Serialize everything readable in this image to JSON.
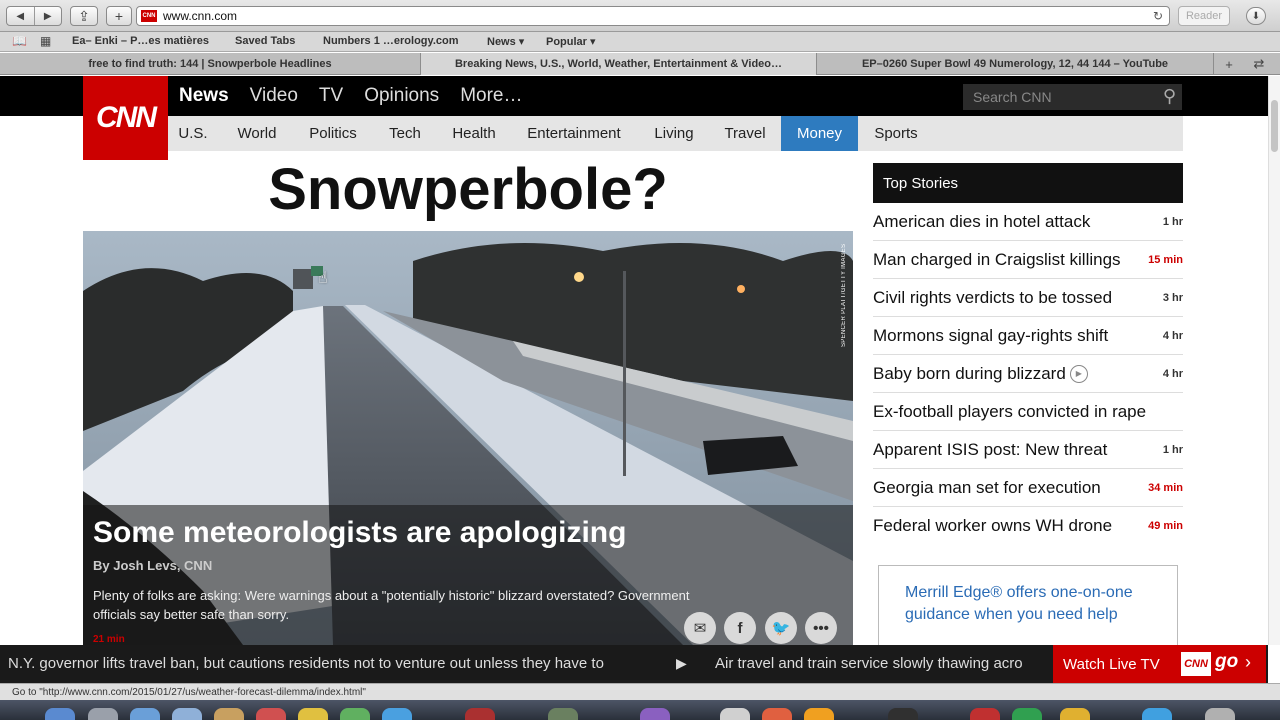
{
  "browser": {
    "url": "www.cnn.com",
    "reader_label": "Reader",
    "bookmarks": [
      "Ea– Enki – P…es matières",
      "Saved Tabs",
      "Numbers 1 …erology.com",
      "News ▾",
      "Popular ▾"
    ],
    "tabs": [
      "free to find truth: 144 | Snowperbole Headlines",
      "Breaking News, U.S., World, Weather, Entertainment & Video…",
      "EP–0260 Super Bowl 49 Numerology, 12, 44 144 – YouTube"
    ],
    "status_text": "Go to \"http://www.cnn.com/2015/01/27/us/weather-forecast-dilemma/index.html\""
  },
  "cnn": {
    "logo": "CNN",
    "main_nav": [
      "News",
      "Video",
      "TV",
      "Opinions",
      "More…"
    ],
    "search_placeholder": "Search CNN",
    "sub_nav": [
      "U.S.",
      "World",
      "Politics",
      "Tech",
      "Health",
      "Entertainment",
      "Living",
      "Travel",
      "Money",
      "Sports"
    ],
    "headline": "Snowperbole?",
    "hero": {
      "photo_credit": "SPENCER PLATT/GETTY IMAGES",
      "title": "Some meteorologists are apologizing",
      "byline": "By Josh Levs, CNN",
      "summary": "Plenty of folks are asking: Were warnings about a \"potentially historic\" blizzard overstated? Government officials say better safe than sorry.",
      "time": "21 min"
    },
    "top_stories": {
      "header": "Top Stories",
      "items": [
        {
          "title": "American dies in hotel attack",
          "time": "1 hr",
          "recent": false
        },
        {
          "title": "Man charged in Craigslist killings",
          "time": "15 min",
          "recent": true
        },
        {
          "title": "Civil rights verdicts to be tossed",
          "time": "3 hr",
          "recent": false
        },
        {
          "title": "Mormons signal gay-rights shift",
          "time": "4 hr",
          "recent": false
        },
        {
          "title": "Baby born during blizzard",
          "time": "4 hr",
          "recent": false,
          "video": true
        },
        {
          "title": "Ex-football players convicted in rape",
          "time": "",
          "recent": false
        },
        {
          "title": "Apparent ISIS post: New threat",
          "time": "1 hr",
          "recent": false
        },
        {
          "title": "Georgia man set for execution",
          "time": "34 min",
          "recent": true
        },
        {
          "title": "Federal worker owns WH drone",
          "time": "49 min",
          "recent": true
        }
      ]
    },
    "ad_text": "Merrill Edge® offers one-on-one guidance when you need help",
    "ticker": [
      "N.Y. governor lifts travel ban, but cautions residents not to venture out unless they have to",
      "Air travel and train service slowly thawing acro"
    ],
    "watch_live": "Watch Live TV",
    "go_logo": "CNN",
    "go_label": "go"
  },
  "colors": {
    "cnn_red": "#cc0000",
    "money_blue": "#2e7bbf",
    "ad_blue": "#2a6bb5"
  }
}
